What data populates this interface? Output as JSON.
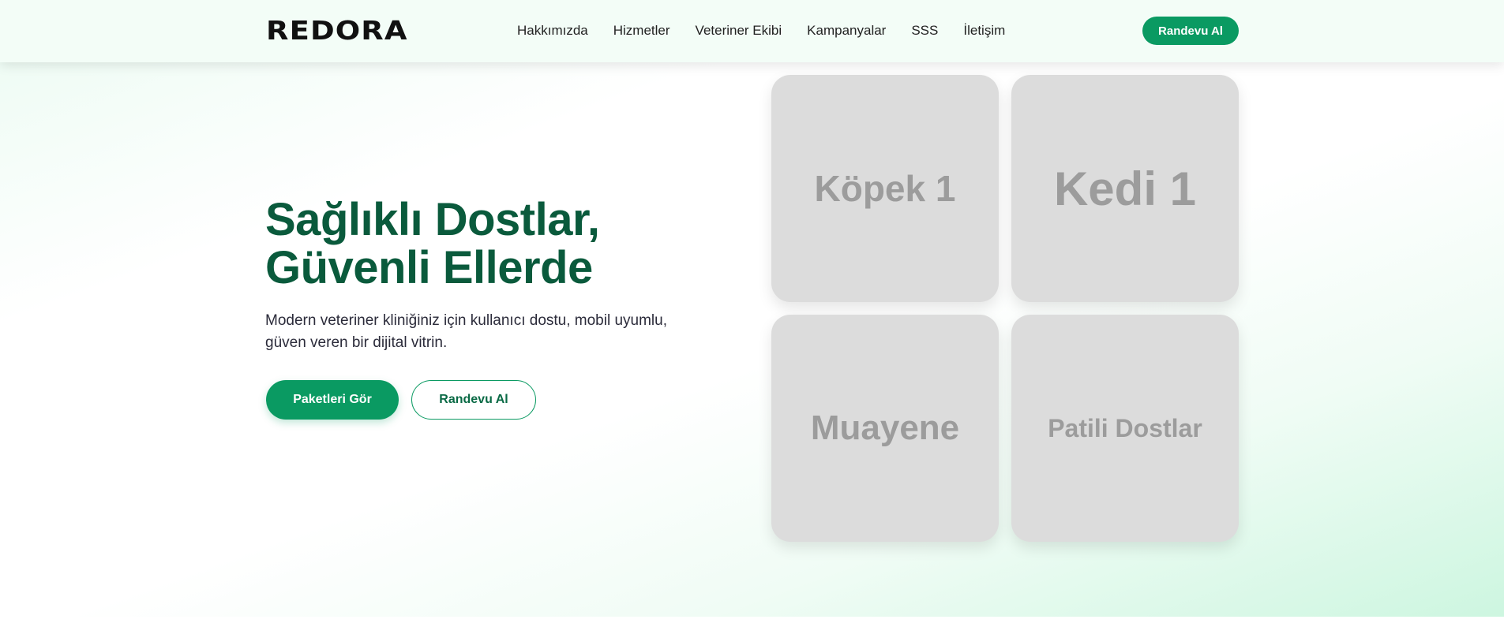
{
  "header": {
    "logo": "REDORA",
    "nav": [
      "Hakkımızda",
      "Hizmetler",
      "Veteriner Ekibi",
      "Kampanyalar",
      "SSS",
      "İletişim"
    ],
    "cta_label": "Randevu Al"
  },
  "hero": {
    "title_line1": "Sağlıklı Dostlar,",
    "title_line2": "Güvenli Ellerde",
    "subtitle_line1": "Modern veteriner kliniğiniz için kullanıcı dostu, mobil uyumlu,",
    "subtitle_line2": "güven veren bir dijital vitrin.",
    "primary_button": "Paketleri Gör",
    "secondary_button": "Randevu Al"
  },
  "gallery": {
    "tiles": [
      "Köpek 1",
      "Kedi 1",
      "Muayene",
      "Patili Dostlar"
    ]
  },
  "colors": {
    "brand_green": "#0a9a62",
    "title_green": "#0a5a3c",
    "tile_gray": "#dcdcdc",
    "tile_text": "#9c9c9c"
  }
}
